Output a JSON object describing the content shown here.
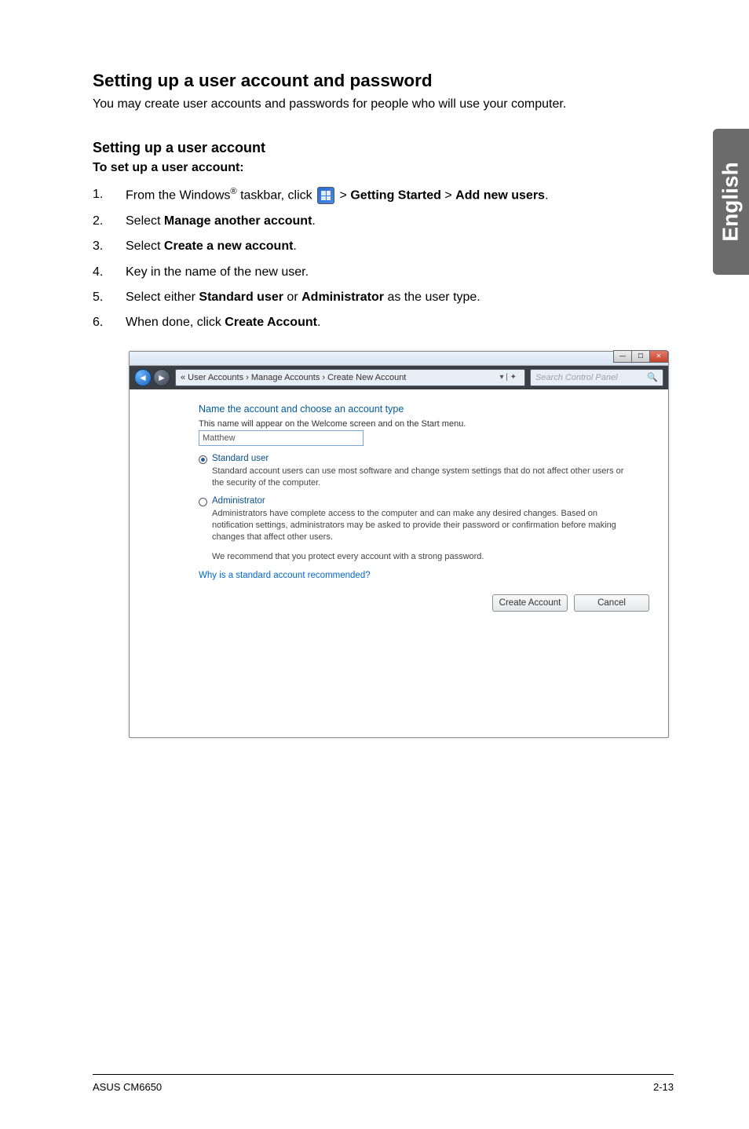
{
  "sideTab": "English",
  "section": {
    "title": "Setting up a user account and password",
    "intro": "You may create user accounts and passwords for people who will use your computer."
  },
  "subSection": {
    "title": "Setting up a user account",
    "todo": "To set up a user account:"
  },
  "steps": {
    "s1_a": "From the Windows",
    "s1_b": " taskbar, click ",
    "s1_c": " > ",
    "s1_bold1": "Getting Started",
    "s1_mid": " > ",
    "s1_bold2": "Add new users",
    "s1_end": ".",
    "s2_a": "Select ",
    "s2_bold": "Manage another account",
    "s2_end": ".",
    "s3_a": "Select ",
    "s3_bold": "Create a new account",
    "s3_end": ".",
    "s4": "Key in the name of the new user.",
    "s5_a": "Select either ",
    "s5_bold1": "Standard user",
    "s5_mid": " or ",
    "s5_bold2": "Administrator",
    "s5_end": " as the user type.",
    "s6_a": "When done, click ",
    "s6_bold": "Create Account",
    "s6_end": "."
  },
  "window": {
    "breadcrumb": "« User Accounts  ›  Manage Accounts  ›  Create New Account",
    "searchPlaceholder": "Search Control Panel",
    "heading": "Name the account and choose an account type",
    "hint": "This name will appear on the Welcome screen and on the Start menu.",
    "nameValue": "Matthew",
    "opt1Label": "Standard user",
    "opt1Desc": "Standard account users can use most software and change system settings that do not affect other users or the security of the computer.",
    "opt2Label": "Administrator",
    "opt2Desc": "Administrators have complete access to the computer and can make any desired changes. Based on notification settings, administrators may be asked to provide their password or confirmation before making changes that affect other users.",
    "recommend": "We recommend that you protect every account with a strong password.",
    "link": "Why is a standard account recommended?",
    "btnCreate": "Create Account",
    "btnCancel": "Cancel"
  },
  "footer": {
    "left": "ASUS CM6650",
    "right": "2-13"
  }
}
